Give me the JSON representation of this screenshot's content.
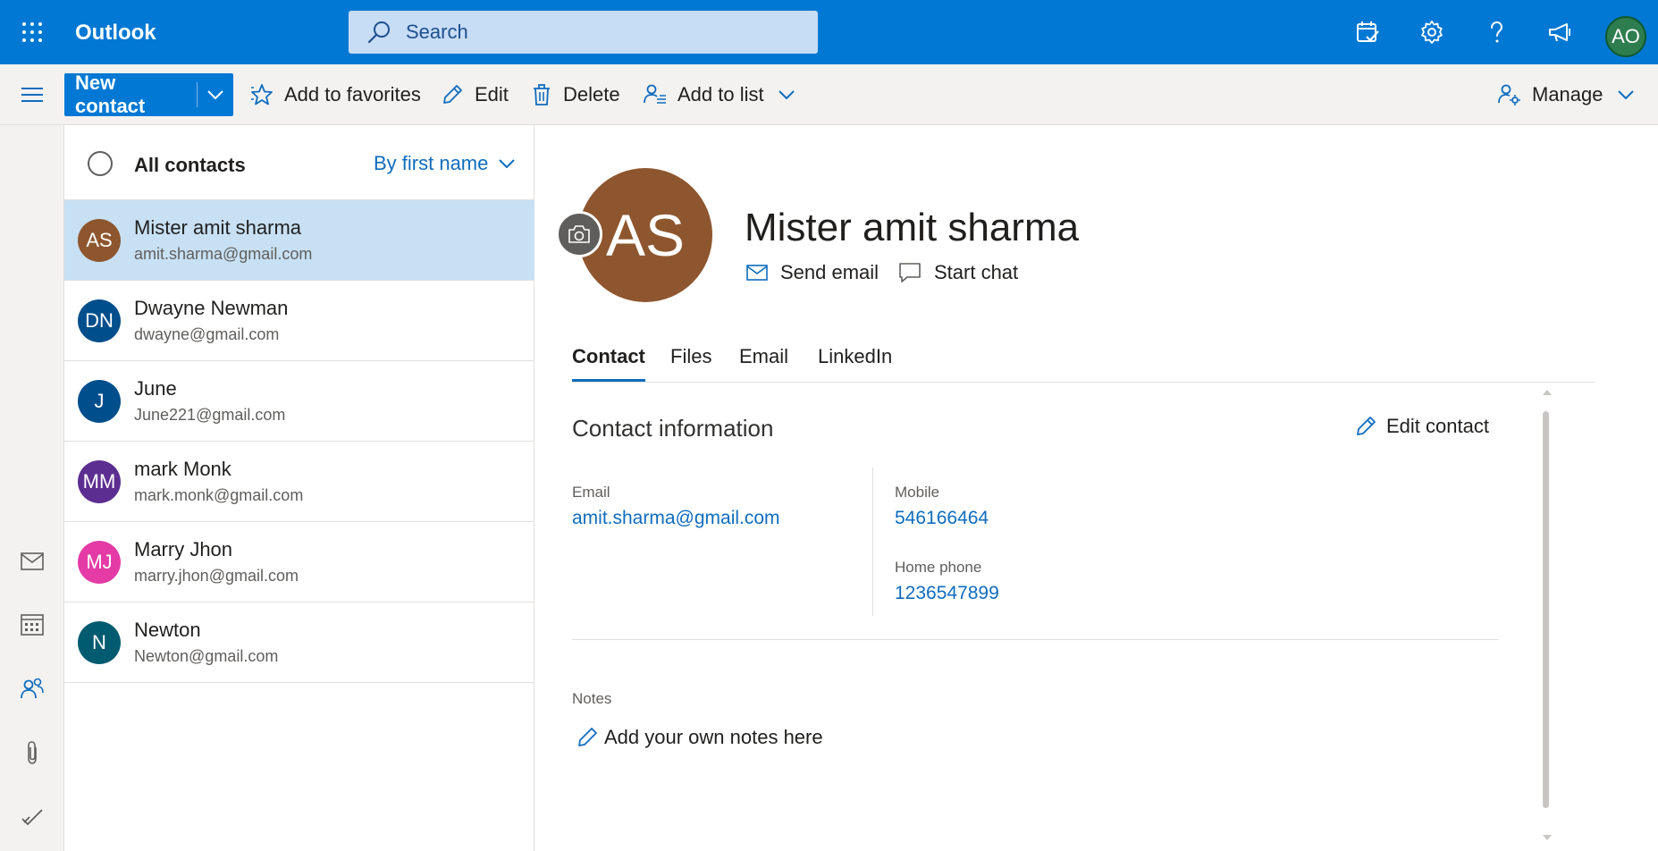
{
  "app": {
    "title": "Outlook"
  },
  "search": {
    "placeholder": "Search"
  },
  "header": {
    "icons": [
      "my-day-icon",
      "gear-icon",
      "help-icon",
      "feedback-icon"
    ],
    "user_initials": "AO",
    "user_color": "#2e7d4f"
  },
  "toolbar": {
    "new_contact": "New contact",
    "add_to_favorites": "Add to favorites",
    "edit": "Edit",
    "delete": "Delete",
    "add_to_list": "Add to list",
    "manage": "Manage"
  },
  "rail": {
    "icons": [
      "mail-icon",
      "calendar-icon",
      "people-icon",
      "attachment-icon",
      "todo-icon"
    ]
  },
  "contact_list": {
    "title": "All contacts",
    "sort": "By first name",
    "contacts": [
      {
        "initials": "AS",
        "name": "Mister amit sharma",
        "email": "amit.sharma@gmail.com",
        "color": "#8e562e",
        "selected": true
      },
      {
        "initials": "DN",
        "name": "Dwayne Newman",
        "email": "dwayne@gmail.com",
        "color": "#004e8c",
        "selected": false
      },
      {
        "initials": "J",
        "name": "June",
        "email": "June221@gmail.com",
        "color": "#004e8c",
        "selected": false
      },
      {
        "initials": "MM",
        "name": "mark Monk",
        "email": "mark.monk@gmail.com",
        "color": "#5c2e91",
        "selected": false
      },
      {
        "initials": "MJ",
        "name": "Marry Jhon",
        "email": "marry.jhon@gmail.com",
        "color": "#e43ba6",
        "selected": false
      },
      {
        "initials": "N",
        "name": "Newton",
        "email": "Newton@gmail.com",
        "color": "#005b70",
        "selected": false
      }
    ]
  },
  "detail": {
    "initials": "AS",
    "avatar_color": "#8e562e",
    "name": "Mister amit sharma",
    "send_email": "Send email",
    "start_chat": "Start chat",
    "tabs": [
      {
        "label": "Contact",
        "active": true
      },
      {
        "label": "Files",
        "active": false
      },
      {
        "label": "Email",
        "active": false
      },
      {
        "label": "LinkedIn",
        "active": false
      }
    ],
    "section_title": "Contact information",
    "edit_contact": "Edit contact",
    "email_label": "Email",
    "email_value": "amit.sharma@gmail.com",
    "mobile_label": "Mobile",
    "mobile_value": "546166464",
    "home_phone_label": "Home phone",
    "home_phone_value": "1236547899",
    "notes_label": "Notes",
    "notes_placeholder": "Add your own notes here"
  },
  "colors": {
    "brand": "#0078d4",
    "link": "#0f6cbd",
    "selected_row": "#c7e0f4"
  }
}
